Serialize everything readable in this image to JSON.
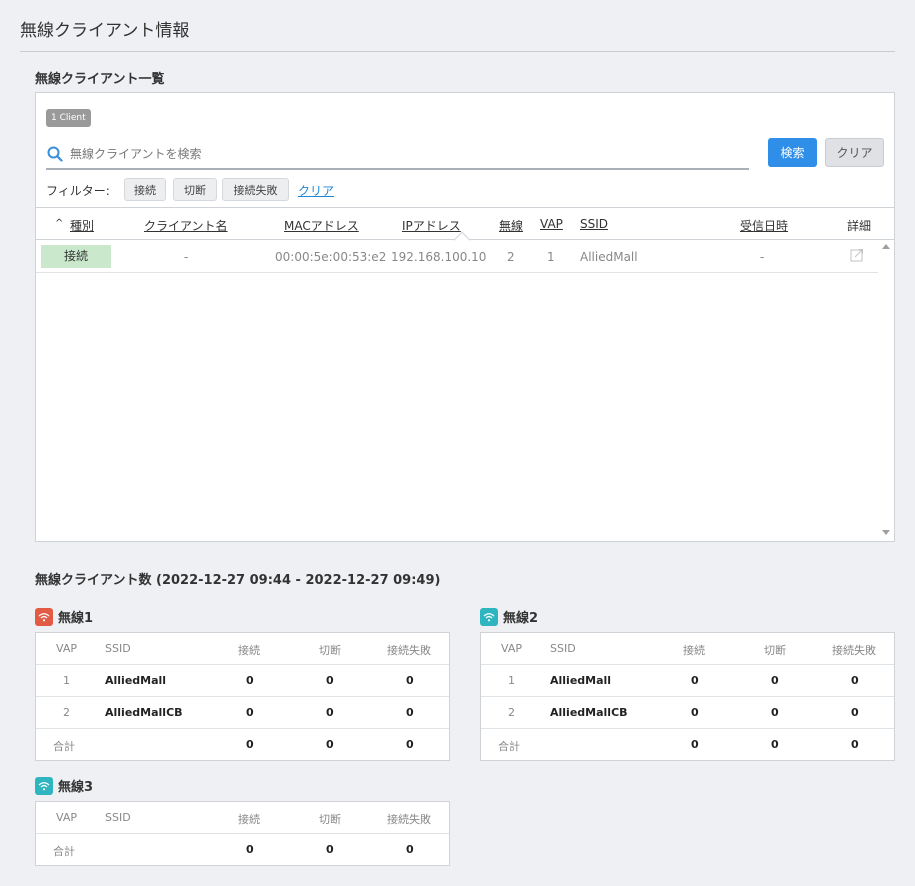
{
  "page": {
    "title": "無線クライアント情報"
  },
  "client_list": {
    "section_title": "無線クライアント一覧",
    "badge": "1 Client",
    "search": {
      "placeholder": "無線クライアントを検索",
      "value": ""
    },
    "buttons": {
      "search": "検索",
      "clear": "クリア"
    },
    "filter": {
      "label": "フィルター:",
      "chips": [
        "接続",
        "切断",
        "接続失敗"
      ],
      "clear_link": "クリア"
    },
    "columns": {
      "sort_indicator": "^",
      "type": "種別",
      "client_name": "クライアント名",
      "mac": "MACアドレス",
      "ip": "IPアドレス",
      "radio": "無線",
      "vap": "VAP",
      "ssid": "SSID",
      "received": "受信日時",
      "detail": "詳細"
    },
    "rows": [
      {
        "type": "接続",
        "client_name": "-",
        "mac": "00:00:5e:00:53:e2",
        "ip": "192.168.100.10",
        "radio": "2",
        "vap": "1",
        "ssid": "AlliedMall",
        "received": "-"
      }
    ]
  },
  "client_count": {
    "section_title": "無線クライアント数 (2022-12-27 09:44 - 2022-12-27 09:49)",
    "headers": [
      "VAP",
      "SSID",
      "接続",
      "切断",
      "接続失敗"
    ],
    "radios": [
      {
        "name": "無線1",
        "color": "#e25b45",
        "rows": [
          {
            "vap": "1",
            "ssid": "AlliedMall",
            "connect": "0",
            "disconnect": "0",
            "fail": "0"
          },
          {
            "vap": "2",
            "ssid": "AlliedMallCB",
            "connect": "0",
            "disconnect": "0",
            "fail": "0"
          }
        ],
        "total": {
          "label": "合計",
          "connect": "0",
          "disconnect": "0",
          "fail": "0"
        }
      },
      {
        "name": "無線2",
        "color": "#2fb5c0",
        "rows": [
          {
            "vap": "1",
            "ssid": "AlliedMall",
            "connect": "0",
            "disconnect": "0",
            "fail": "0"
          },
          {
            "vap": "2",
            "ssid": "AlliedMallCB",
            "connect": "0",
            "disconnect": "0",
            "fail": "0"
          }
        ],
        "total": {
          "label": "合計",
          "connect": "0",
          "disconnect": "0",
          "fail": "0"
        }
      },
      {
        "name": "無線3",
        "color": "#2fb5c0",
        "rows": [],
        "total": {
          "label": "合計",
          "connect": "0",
          "disconnect": "0",
          "fail": "0"
        }
      }
    ]
  },
  "icons": {
    "search": "search-icon",
    "detail": "external-link-icon",
    "radio": "wifi-icon"
  },
  "colors": {
    "primary_button": "#2f8ee8",
    "link": "#1f86d6",
    "connected_bg": "#c9e8cc"
  }
}
